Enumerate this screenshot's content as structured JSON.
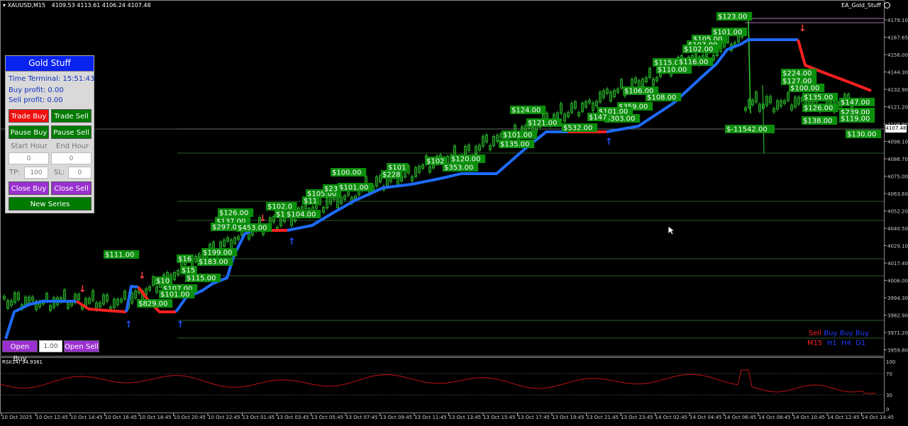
{
  "header": {
    "symbol": "XAUUSD,M15",
    "ohlc": "4109.53 4113.61 4106.24 4107.48"
  },
  "ea_label": "EA_Gold_Stuff",
  "ea_icon": "smiley-icon",
  "panel": {
    "title": "Gold Stuff",
    "time_terminal": "Time Terminal: 15:51:43",
    "buy_profit": "Buy profit: 0.00",
    "sell_profit": "Sell profit: 0.00",
    "trade_buy": "Trade Buy",
    "trade_sell": "Trade Sell",
    "pause_buy": "Pause Buy",
    "pause_sell": "Pause Sell",
    "start_hour_label": "Start Hour",
    "end_hour_label": "End Hour",
    "start_hour_value": "0",
    "end_hour_value": "0",
    "tp_label": "TP:",
    "tp_value": "100",
    "sl_label": "SL:",
    "sl_value": "0",
    "close_buy": "Close Buy",
    "close_sell": "Close Sell",
    "new_series": "New Series"
  },
  "bottom_controls": {
    "open_buy": "Open Buy",
    "lot": "1.00",
    "open_sell": "Open Sell"
  },
  "trend_legend": {
    "signals": [
      "Sell",
      "Buy",
      "Buy",
      "Buy"
    ],
    "timeframes": [
      "M15",
      "H1",
      "H4",
      "D1"
    ]
  },
  "current_price_label": "4107.48",
  "price_axis": [
    "4179.10",
    "4167.65",
    "4156.00",
    "4144.30",
    "4132.90",
    "4121.20",
    "4109.90",
    "4098.10",
    "4086.70",
    "4075.00",
    "4063.60",
    "4052.20",
    "4040.50",
    "4029.10",
    "4017.40",
    "4006.00",
    "3994.30",
    "3982.90",
    "3971.20",
    "3959.80"
  ],
  "time_axis": [
    "10 Oct 2025",
    "10 Oct 12:45",
    "10 Oct 14:45",
    "10 Oct 16:45",
    "10 Oct 18:45",
    "10 Oct 20:45",
    "10 Oct 22:45",
    "13 Oct 01:45",
    "13 Oct 03:45",
    "13 Oct 05:45",
    "13 Oct 07:45",
    "13 Oct 09:45",
    "13 Oct 11:45",
    "13 Oct 13:45",
    "13 Oct 15:45",
    "13 Oct 17:45",
    "13 Oct 19:45",
    "13 Oct 21:45",
    "13 Oct 23:45",
    "14 Oct 02:45",
    "14 Oct 04:45",
    "14 Oct 06:45",
    "14 Oct 08:45",
    "14 Oct 10:45",
    "14 Oct 12:45",
    "14 Oct 14:45"
  ],
  "rsi": {
    "label": "RSI(14) 34.9381",
    "levels": [
      "100",
      "70",
      "30",
      "0"
    ]
  },
  "profit_labels": [
    "$123.00",
    "$101.00",
    "$105.00",
    "$107.00",
    "$102.00",
    "$115.00",
    "$116.00",
    "$110.00",
    "$224.00",
    "$127.00",
    "$100.00",
    "$135.00",
    "$147.00",
    "$239.00",
    "$119.00",
    "$138.00",
    "$130.00",
    "$126.00",
    "$-11542.00",
    "$106.00",
    "$108.00",
    "$359.00",
    "$303.00",
    "$101.00",
    "$147",
    "$124.00",
    "$121.00",
    "$532.00",
    "$101.00",
    "$135.00",
    "$120.00",
    "$353.00",
    "$102",
    "$101",
    "$228",
    "$100.00",
    "$101.00",
    "$105.00",
    "$126.00",
    "$137.00",
    "$297.00",
    "$453.00",
    "$102.0",
    "$101.00",
    "$104.00",
    "$111.00",
    "$199.00",
    "$183.00",
    "$115.00",
    "$107.00",
    "$101.00",
    "$829.00",
    "$11",
    "$16",
    "$23",
    "$15",
    "$10"
  ],
  "colors": {
    "trend_up": "#1e6bff",
    "trend_down": "#ff2020",
    "label_bg": "#0c8f0c",
    "candle": "#2ed02e",
    "rsi": "#c01010"
  }
}
